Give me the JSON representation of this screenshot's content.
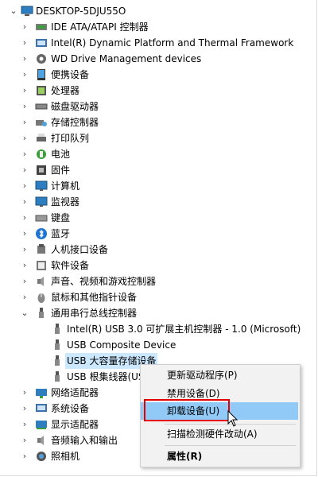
{
  "root": {
    "label": "DESKTOP-5DJU55O",
    "icon": "computer-icon"
  },
  "items": [
    {
      "label": "IDE ATA/ATAPI 控制器",
      "icon": "ide-controller-icon",
      "expanded": false
    },
    {
      "label": "Intel(R) Dynamic Platform and Thermal Framework",
      "icon": "device-folder-icon",
      "expanded": false
    },
    {
      "label": "WD Drive Management devices",
      "icon": "gear-icon",
      "expanded": false
    },
    {
      "label": "便携设备",
      "icon": "portable-device-icon",
      "expanded": false
    },
    {
      "label": "处理器",
      "icon": "processor-icon",
      "expanded": false
    },
    {
      "label": "磁盘驱动器",
      "icon": "disk-drive-icon",
      "expanded": false
    },
    {
      "label": "存储控制器",
      "icon": "storage-controller-icon",
      "expanded": false
    },
    {
      "label": "打印队列",
      "icon": "printer-icon",
      "expanded": false
    },
    {
      "label": "电池",
      "icon": "battery-icon",
      "expanded": false
    },
    {
      "label": "固件",
      "icon": "firmware-icon",
      "expanded": false
    },
    {
      "label": "计算机",
      "icon": "monitor-icon",
      "expanded": false
    },
    {
      "label": "监视器",
      "icon": "monitor-icon",
      "expanded": false
    },
    {
      "label": "键盘",
      "icon": "keyboard-icon",
      "expanded": false
    },
    {
      "label": "蓝牙",
      "icon": "bluetooth-icon",
      "expanded": false
    },
    {
      "label": "人机接口设备",
      "icon": "hid-icon",
      "expanded": false
    },
    {
      "label": "软件设备",
      "icon": "software-device-icon",
      "expanded": false
    },
    {
      "label": "声音、视频和游戏控制器",
      "icon": "speaker-icon",
      "expanded": false
    },
    {
      "label": "鼠标和其他指针设备",
      "icon": "mouse-icon",
      "expanded": false
    },
    {
      "label": "通用串行总线控制器",
      "icon": "usb-icon",
      "expanded": true
    }
  ],
  "usb_children": [
    {
      "label": "Intel(R) USB 3.0 可扩展主机控制器 - 1.0 (Microsoft)",
      "icon": "usb-icon"
    },
    {
      "label": "USB Composite Device",
      "icon": "usb-icon"
    },
    {
      "label": "USB 大容量存储设备",
      "icon": "usb-icon",
      "selected": true
    },
    {
      "label": "USB 根集线器(US",
      "icon": "usb-icon"
    }
  ],
  "items_after": [
    {
      "label": "网络适配器",
      "icon": "network-adapter-icon"
    },
    {
      "label": "系统设备",
      "icon": "system-device-icon"
    },
    {
      "label": "显示适配器",
      "icon": "display-adapter-icon"
    },
    {
      "label": "音频输入和输出",
      "icon": "speaker-icon"
    },
    {
      "label": "照相机",
      "icon": "camera-icon"
    }
  ],
  "context_menu": {
    "items": [
      {
        "label": "更新驱动程序(P)"
      },
      {
        "label": "禁用设备(D)"
      },
      {
        "label": "卸载设备(U)",
        "highlighted": true
      },
      {
        "label": "扫描检测硬件改动(A)"
      },
      {
        "label": "属性(R)",
        "bold": true
      }
    ],
    "highlight_color": "#91c9f7",
    "callout_color": "#e60000"
  }
}
